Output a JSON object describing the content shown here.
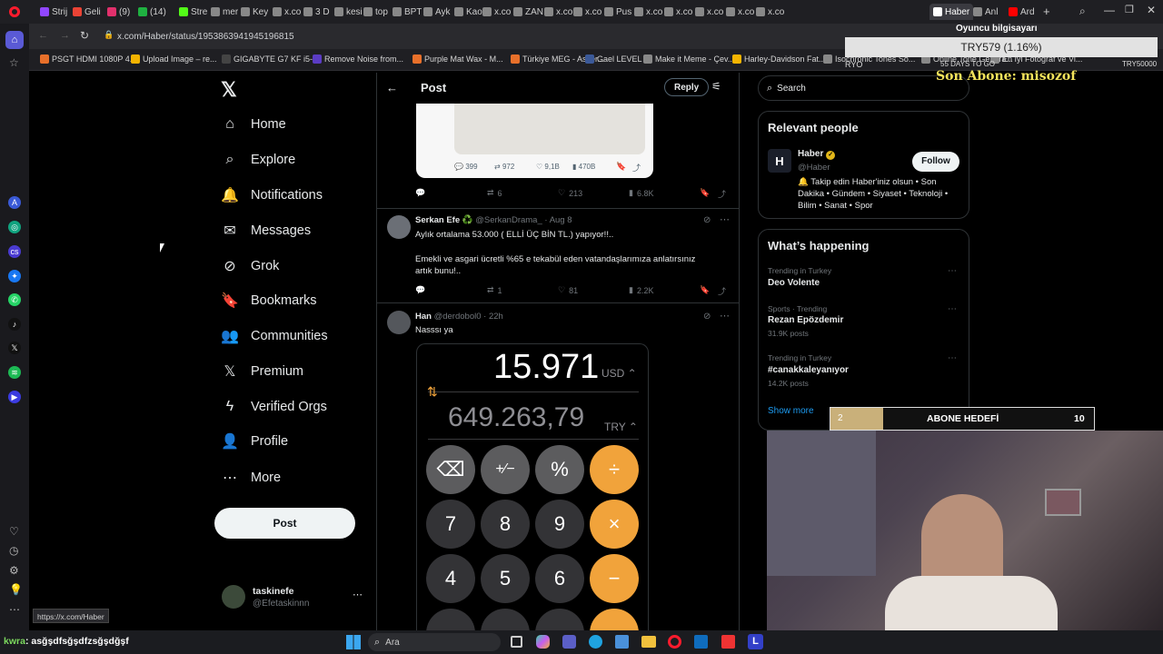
{
  "browser": {
    "tabs": [
      {
        "label": "Strij",
        "color": "#9146ff"
      },
      {
        "label": "Geli",
        "color": "#ea4335"
      },
      {
        "label": "(9)",
        "color": "#e1306c"
      },
      {
        "label": "(14)",
        "color": "#1fb141"
      },
      {
        "label": "Stre",
        "color": "#53fc18"
      },
      {
        "label": "mer",
        "color": "#888888"
      },
      {
        "label": "Key",
        "color": "#888888"
      },
      {
        "label": "x.co",
        "color": "#888888"
      },
      {
        "label": "3 D",
        "color": "#888888"
      },
      {
        "label": "kesi",
        "color": "#888888"
      },
      {
        "label": "top",
        "color": "#888888"
      },
      {
        "label": "BPT",
        "color": "#888888"
      },
      {
        "label": "Ayk",
        "color": "#888888"
      },
      {
        "label": "Kao",
        "color": "#888888"
      },
      {
        "label": "x.co",
        "color": "#888888"
      },
      {
        "label": "ZAN",
        "color": "#888888"
      },
      {
        "label": "x.co",
        "color": "#888888"
      },
      {
        "label": "x.co",
        "color": "#888888"
      },
      {
        "label": "Pus",
        "color": "#888888"
      },
      {
        "label": "x.co",
        "color": "#888888"
      },
      {
        "label": "x.co",
        "color": "#888888"
      },
      {
        "label": "x.co",
        "color": "#888888"
      },
      {
        "label": "x.co",
        "color": "#888888"
      },
      {
        "label": "x.co",
        "color": "#888888"
      },
      {
        "label": "Haber",
        "color": "#ffffff"
      },
      {
        "label": "Anl",
        "color": "#888888"
      },
      {
        "label": "Ard",
        "color": "#ff0000"
      }
    ],
    "url": "x.com/Haber/status/1953863941945196815",
    "bookmarks": [
      {
        "label": "PSGT HDMI 1080P 4...",
        "color": "#e8702a"
      },
      {
        "label": "Upload Image – re...",
        "color": "#f4b400"
      },
      {
        "label": "GIGABYTE G7 KF i5-...",
        "color": "#444444"
      },
      {
        "label": "Remove Noise from...",
        "color": "#5b3cc4"
      },
      {
        "label": "Purple Mat Wax - M...",
        "color": "#e8702a"
      },
      {
        "label": "Türkiye MEG - Asker...",
        "color": "#e8702a"
      },
      {
        "label": "Gael LEVEL",
        "color": "#3b5998"
      },
      {
        "label": "Make it Meme - Çev...",
        "color": "#888888"
      },
      {
        "label": "Harley-Davidson Fat...",
        "color": "#f4b400"
      },
      {
        "label": "Isochronic Tones So...",
        "color": "#888888"
      },
      {
        "label": "Online Tone Genera...",
        "color": "#888888"
      },
      {
        "label": "En İyi Fotoğraf ve Vi...",
        "color": "#888888"
      }
    ]
  },
  "x": {
    "nav": [
      {
        "label": "Home",
        "icon": "home-icon",
        "glyph": "⌂"
      },
      {
        "label": "Explore",
        "icon": "search-icon",
        "glyph": "⌕"
      },
      {
        "label": "Notifications",
        "icon": "bell-icon",
        "glyph": "🔔"
      },
      {
        "label": "Messages",
        "icon": "envelope-icon",
        "glyph": "✉"
      },
      {
        "label": "Grok",
        "icon": "grok-icon",
        "glyph": "⊘"
      },
      {
        "label": "Bookmarks",
        "icon": "bookmark-icon",
        "glyph": "🔖"
      },
      {
        "label": "Communities",
        "icon": "communities-icon",
        "glyph": "👥"
      },
      {
        "label": "Premium",
        "icon": "x-logo-icon",
        "glyph": "𝕏"
      },
      {
        "label": "Verified Orgs",
        "icon": "lightning-icon",
        "glyph": "ϟ"
      },
      {
        "label": "Profile",
        "icon": "person-icon",
        "glyph": "👤"
      },
      {
        "label": "More",
        "icon": "more-circle-icon",
        "glyph": "⋯"
      }
    ],
    "post_button": "Post",
    "account": {
      "name": "taskinefe",
      "handle": "@Efetaskinnn"
    },
    "header": {
      "title": "Post",
      "reply_label": "Reply"
    },
    "quoted_stats": {
      "replies": "399",
      "reposts": "972",
      "likes": "9,1B",
      "views": "470B"
    },
    "first_post_actions": {
      "reposts": "6",
      "likes": "213",
      "views": "6.8K"
    },
    "replies": [
      {
        "name": "Serkan Efe ♻️",
        "handle": "@SerkanDrama_",
        "date": "Aug 8",
        "line1": "Aylık ortalama 53.000 ( ELLİ ÜÇ BİN TL.) yapıyor!!..",
        "line2": "Emekli ve asgari ücretli %65 e tekabül eden vatandaşlarımıza anlatırsınız",
        "line3": "artık bunu!..",
        "reposts": "1",
        "likes": "81",
        "views": "2.2K"
      },
      {
        "name": "Han",
        "handle": "@derdobol0",
        "date": "22h",
        "text": "Nasssı ya"
      }
    ],
    "calculator": {
      "top_value": "15.971",
      "top_currency": "USD",
      "bottom_value": "649.263,79",
      "bottom_currency": "TRY",
      "keys_row1": [
        "⌫",
        "+⁄−",
        "%",
        "÷"
      ],
      "keys_row2": [
        "7",
        "8",
        "9",
        "×"
      ],
      "keys_row3": [
        "4",
        "5",
        "6",
        "−"
      ]
    },
    "search_placeholder": "Search",
    "relevant": {
      "title": "Relevant people",
      "name": "Haber",
      "handle": "@Haber",
      "follow": "Follow",
      "bio1": "🔔 Takip edin Haber'iniz olsun • Son",
      "bio2": "Dakika • Gündem • Siyaset • Teknoloji •",
      "bio3": "Bilim • Sanat • Spor"
    },
    "happening": {
      "title": "What’s happening",
      "items": [
        {
          "meta": "Trending in Turkey",
          "topic": "Deo Volente",
          "posts": ""
        },
        {
          "meta": "Sports · Trending",
          "topic": "Rezan Epözdemir",
          "posts": "31.9K posts"
        },
        {
          "meta": "Trending in Turkey",
          "topic": "#canakkaleyanıyor",
          "posts": "14.2K posts"
        }
      ],
      "show_more": "Show more"
    }
  },
  "overlay": {
    "goal_title": "Oyuncu bilgisayarı",
    "goal_value": "TRY579 (1.16%)",
    "goal_left": "RYO",
    "goal_mid": "55 DAYS TO GO",
    "goal_right": "TRY50000",
    "sub_text": "Son Abone: misozof",
    "sub_goal_current": "2",
    "sub_goal_label": "ABONE HEDEFİ",
    "sub_goal_target": "10",
    "sub_goal_progress": 0.2,
    "chat_user": "kwra",
    "chat_msg": ": asğşdfsğşdfzsğşdğşf",
    "status_url": "https://x.com/Haber"
  },
  "taskbar": {
    "search": "Ara"
  }
}
